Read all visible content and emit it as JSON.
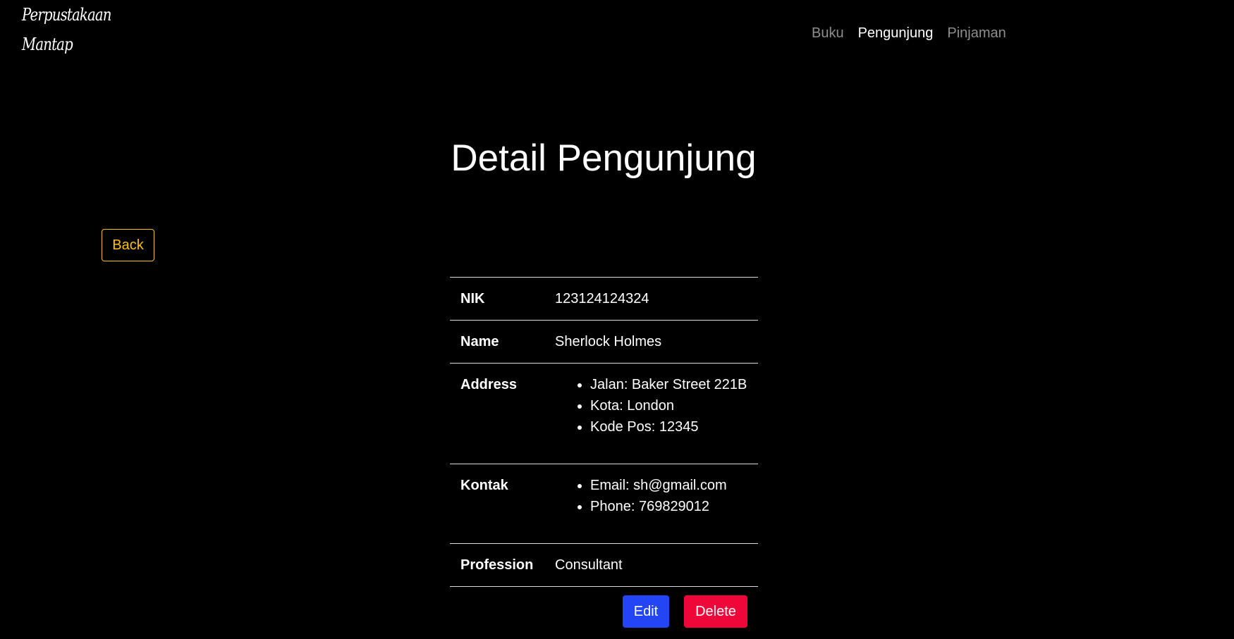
{
  "brand": {
    "line1": "Perpustakaan",
    "line2": "Mantap"
  },
  "nav": {
    "items": [
      {
        "label": "Buku",
        "active": false
      },
      {
        "label": "Pengunjung",
        "active": true
      },
      {
        "label": "Pinjaman",
        "active": false
      }
    ]
  },
  "page": {
    "title": "Detail Pengunjung",
    "back_label": "Back"
  },
  "detail": {
    "nik_label": "NIK",
    "nik_value": "123124124324",
    "name_label": "Name",
    "name_value": "Sherlock Holmes",
    "address_label": "Address",
    "address_items": [
      "Jalan: Baker Street 221B",
      "Kota: London",
      "Kode Pos: 12345"
    ],
    "kontak_label": "Kontak",
    "kontak_items": [
      "Email: sh@gmail.com",
      "Phone: 769829012"
    ],
    "profession_label": "Profession",
    "profession_value": "Consultant"
  },
  "actions": {
    "edit_label": "Edit",
    "delete_label": "Delete"
  },
  "colors": {
    "background": "#000000",
    "back_outline": "#ffc107",
    "edit": "#2445f5",
    "delete": "#f0073a",
    "nav_inactive": "#8e8e8e"
  }
}
